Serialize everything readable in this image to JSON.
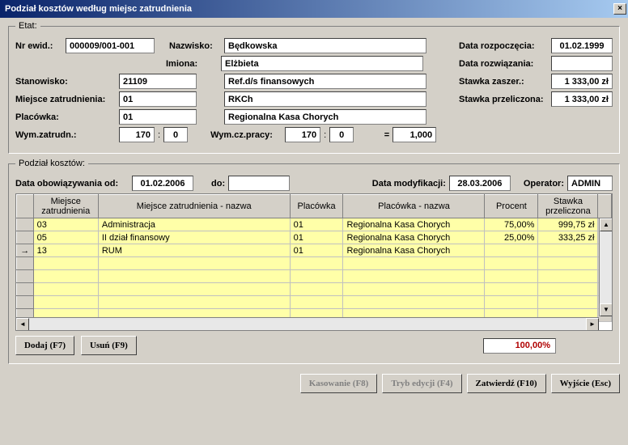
{
  "window": {
    "title": "Podział kosztów według miejsc zatrudnienia",
    "close": "×"
  },
  "etat": {
    "legend": "Etat:",
    "nr_ewid_lbl": "Nr ewid.:",
    "nr_ewid": "000009/001-001",
    "nazwisko_lbl": "Nazwisko:",
    "nazwisko": "Będkowska",
    "imiona_lbl": "Imiona:",
    "imiona": "Elżbieta",
    "data_rozp_lbl": "Data rozpoczęcia:",
    "data_rozp": "01.02.1999",
    "data_rozw_lbl": "Data rozwiązania:",
    "data_rozw": "",
    "stanowisko_lbl": "Stanowisko:",
    "stanowisko_kod": "21109",
    "stanowisko_nazwa": "Ref.d/s finansowych",
    "stawka_zaszer_lbl": "Stawka zaszer.:",
    "stawka_zaszer": "1 333,00 zł",
    "miejsce_lbl": "Miejsce zatrudnienia:",
    "miejsce_kod": "01",
    "miejsce_nazwa": "RKCh",
    "stawka_przel_lbl": "Stawka przeliczona:",
    "stawka_przel": "1 333,00 zł",
    "placowka_lbl": "Placówka:",
    "placowka_kod": "01",
    "placowka_nazwa": "Regionalna Kasa Chorych",
    "wym_zatr_lbl": "Wym.zatrudn.:",
    "wym_zatr_1": "170",
    "wym_zatr_2": "0",
    "wym_cz_lbl": "Wym.cz.pracy:",
    "wym_cz_1": "170",
    "wym_cz_2": "0",
    "eq": "=",
    "wym_cz_ratio": "1,000"
  },
  "podzial": {
    "legend": "Podział kosztów:",
    "data_od_lbl": "Data obowiązywania od:",
    "data_od": "01.02.2006",
    "do_lbl": "do:",
    "do": "",
    "data_mod_lbl": "Data modyfikacji:",
    "data_mod": "28.03.2006",
    "operator_lbl": "Operator:",
    "operator": "ADMIN",
    "total": "100,00%"
  },
  "grid": {
    "cols": {
      "sel": "",
      "mz": "Miejsce zatrudnienia",
      "mzn": "Miejsce zatrudnienia - nazwa",
      "pl": "Placówka",
      "pln": "Placówka - nazwa",
      "proc": "Procent",
      "st": "Stawka przeliczona"
    },
    "rows": [
      {
        "sel": "",
        "mz": "03",
        "mzn": "Administracja",
        "pl": "01",
        "pln": "Regionalna Kasa Chorych",
        "proc": "75,00%",
        "st": "999,75 zł"
      },
      {
        "sel": "",
        "mz": "05",
        "mzn": "II dział finansowy",
        "pl": "01",
        "pln": "Regionalna Kasa Chorych",
        "proc": "25,00%",
        "st": "333,25 zł"
      },
      {
        "sel": "→",
        "mz": "13",
        "mzn": "RUM",
        "pl": "01",
        "pln": "Regionalna Kasa Chorych",
        "proc": "",
        "st": ""
      }
    ]
  },
  "buttons": {
    "dodaj": "Dodaj (F7)",
    "usun": "Usuń (F9)",
    "kasowanie": "Kasowanie (F8)",
    "trybedycji": "Tryb edycji (F4)",
    "zatwierdz": "Zatwierdź (F10)",
    "wyjscie": "Wyjście (Esc)"
  }
}
